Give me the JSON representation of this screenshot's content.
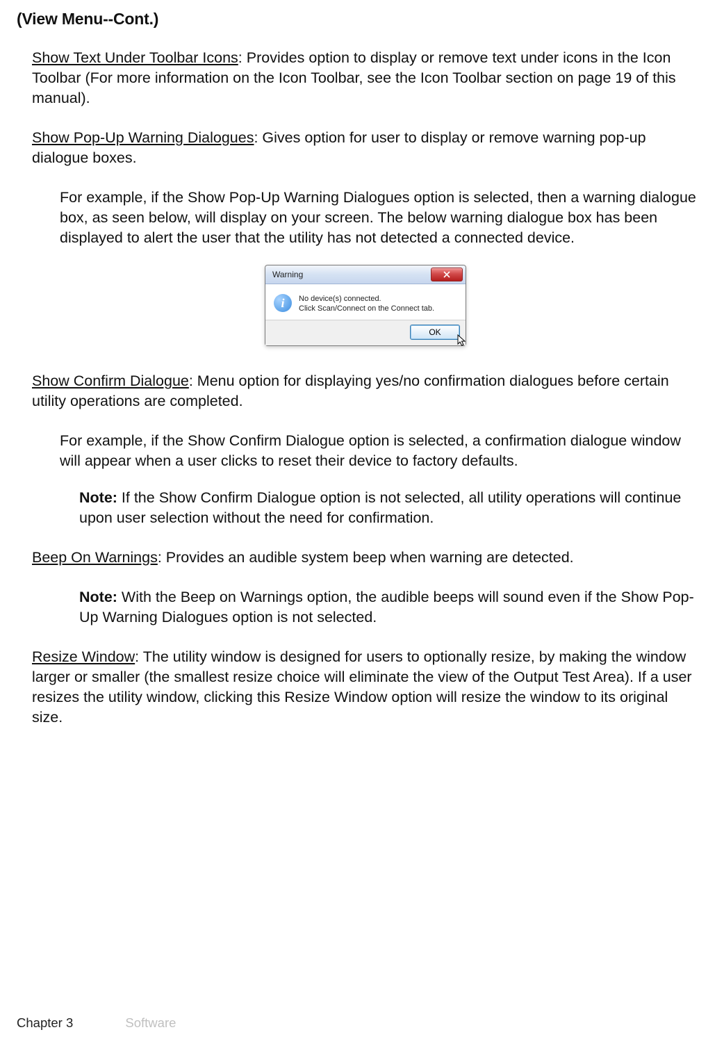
{
  "heading": "(View Menu--Cont.)",
  "entries": {
    "show_text_under_icons": {
      "title": "Show Text Under Toolbar Icons",
      "desc": ": Provides option to display or remove text under icons in the Icon Toolbar (For more information on the Icon Toolbar, see the Icon Toolbar section on page 19 of this manual)."
    },
    "show_popup": {
      "title": "Show Pop-Up Warning Dialogues",
      "desc": ": Gives option for user to display or remove warning pop-up dialogue boxes."
    },
    "show_popup_example": "For example, if the Show Pop-Up Warning Dialogues option is selected, then a warning dialogue box, as seen below, will display on your screen. The below warning dialogue box has been displayed  to alert the user that the utility has not detected a connected device.",
    "dialog": {
      "title": "Warning",
      "line1": "No device(s) connected.",
      "line2": "Click Scan/Connect on the Connect tab.",
      "ok": "OK"
    },
    "show_confirm": {
      "title": "Show Confirm Dialogue",
      "desc": ": Menu option for displaying yes/no confirmation dialogues before certain utility operations are completed."
    },
    "show_confirm_example": "For example, if the Show Confirm Dialogue option is selected, a confirmation dialogue window will appear when a user clicks to reset their device to factory defaults.",
    "show_confirm_note": {
      "label": "Note:",
      "text": " If the Show Confirm Dialogue option is not selected, all utility operations will continue upon user selection without the need for confirmation."
    },
    "beep": {
      "title": "Beep On Warnings",
      "desc": ": Provides an audible system beep when warning are detected."
    },
    "beep_note": {
      "label": "Note:",
      "text": " With the Beep on Warnings option, the audible beeps will sound even if the Show Pop-Up Warning Dialogues option is not  selected."
    },
    "resize": {
      "title": "Resize Window",
      "desc": ": The utility window is designed for users to optionally resize, by making the window larger or smaller (the smallest resize choice will eliminate the view of the Output Test Area). If a user resizes the utility window, clicking this Resize Window option will resize the window to its original size."
    }
  },
  "footer": {
    "chapter": "Chapter 3",
    "section": "Software"
  }
}
